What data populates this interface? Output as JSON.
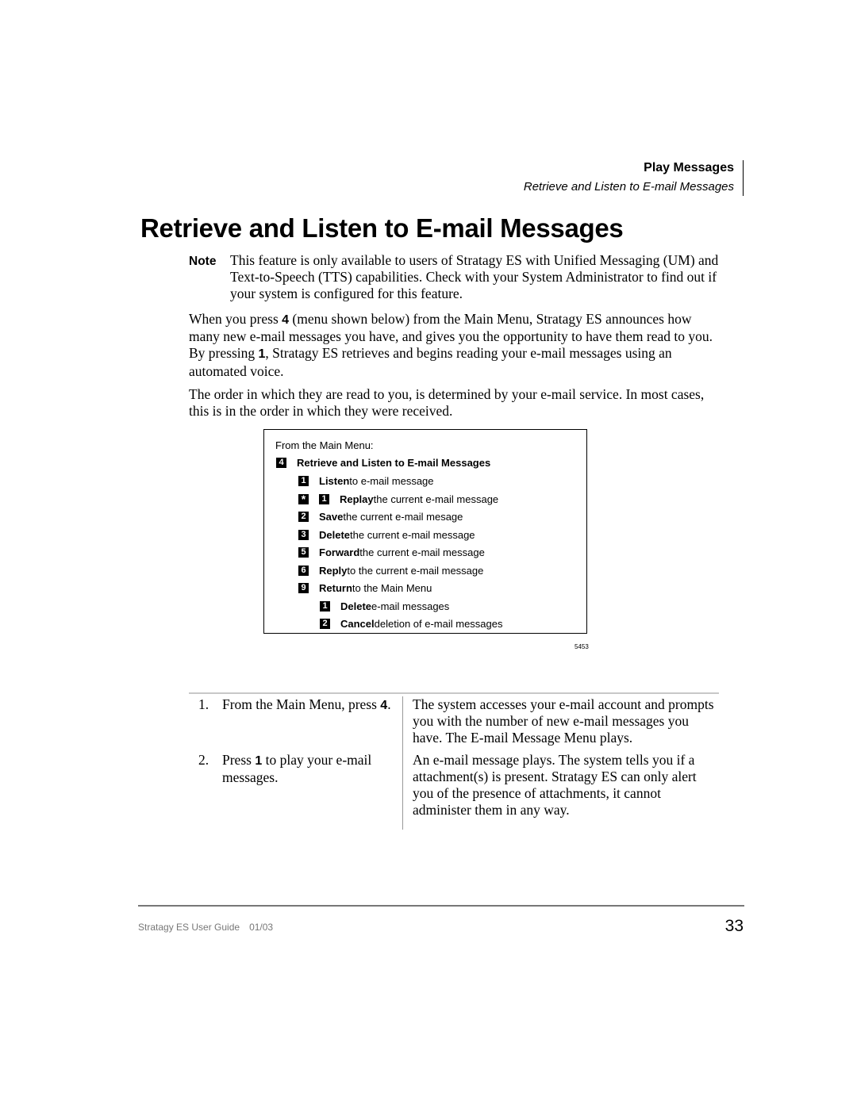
{
  "header": {
    "section": "Play Messages",
    "subsection": "Retrieve and Listen to E-mail Messages"
  },
  "title": "Retrieve and Listen to E-mail Messages",
  "note": {
    "label": "Note",
    "text": "This feature is only available to users of Stratagy ES with Unified Messaging (UM) and Text-to-Speech (TTS) capabilities. Check with your System Administrator to find out if your system is configured for this feature."
  },
  "paragraphs": {
    "p1": {
      "before_key1": "When you press ",
      "key1": "4",
      "middle": " (menu shown below) from the Main Menu, Stratagy ES announces how many new e-mail messages you have, and gives you the opportunity to have them read to you. By pressing ",
      "key2": "1",
      "after": ", Stratagy ES retrieves and begins reading your e-mail messages using an automated voice."
    },
    "p2": "The order in which they are read to you, is determined by your e-mail service. In most cases, this is in the order in which they were received."
  },
  "menu": {
    "intro": "From the Main Menu:",
    "title_key": "4",
    "title": "Retrieve and Listen to E-mail Messages",
    "items": [
      {
        "keys": [
          "1"
        ],
        "bold": "Listen",
        "rest": " to e-mail message"
      },
      {
        "keys": [
          "*",
          "1"
        ],
        "bold": "Replay",
        "rest": " the current e-mail message"
      },
      {
        "keys": [
          "2"
        ],
        "bold": "Save",
        "rest": " the current e-mail mesage"
      },
      {
        "keys": [
          "3"
        ],
        "bold": "Delete",
        "rest": " the current e-mail message"
      },
      {
        "keys": [
          "5"
        ],
        "bold": "Forward",
        "rest": " the current e-mail message"
      },
      {
        "keys": [
          "6"
        ],
        "bold": "Reply",
        "rest": " to the current e-mail message"
      },
      {
        "keys": [
          "9"
        ],
        "bold": "Return",
        "rest": " to the Main Menu"
      },
      {
        "keys": [
          "1"
        ],
        "bold": "Delete",
        "rest": " e-mail messages"
      },
      {
        "keys": [
          "2"
        ],
        "bold": "Cancel",
        "rest": " deletion of e-mail messages"
      }
    ],
    "figure_number": "5453"
  },
  "steps": [
    {
      "number": "1.",
      "action_before": "From the Main Menu, press ",
      "action_key": "4",
      "action_after": ".",
      "result": "The system accesses your e-mail account and prompts you with the number of new e-mail messages you have. The E-mail Message Menu plays."
    },
    {
      "number": "2.",
      "action_before": "Press ",
      "action_key": "1",
      "action_after": " to play your e-mail messages.",
      "result": "An e-mail message plays. The system tells you if a attachment(s) is present. Stratagy ES can only alert you of the presence of attachments, it cannot administer them in any way."
    }
  ],
  "footer": {
    "guide": "Stratagy ES User Guide",
    "date": "01/03",
    "page_number": "33"
  }
}
